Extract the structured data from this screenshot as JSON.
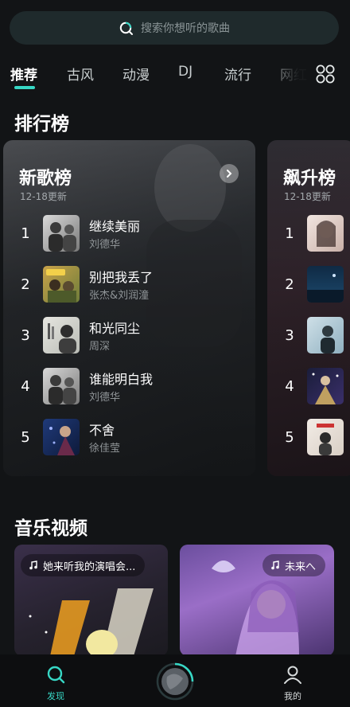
{
  "search": {
    "placeholder": "搜索你想听的歌曲"
  },
  "tabs": [
    {
      "label": "推荐",
      "active": true
    },
    {
      "label": "古风"
    },
    {
      "label": "动漫"
    },
    {
      "label": "DJ"
    },
    {
      "label": "流行"
    },
    {
      "label": "网红"
    }
  ],
  "sections": {
    "charts_title": "排行榜",
    "mv_title": "音乐视频"
  },
  "charts": [
    {
      "title": "新歌榜",
      "date": "12-18更新",
      "rows": [
        {
          "rank": "1",
          "song": "继续美丽",
          "artist": "刘德华"
        },
        {
          "rank": "2",
          "song": "别把我丢了",
          "artist": "张杰&刘润潼"
        },
        {
          "rank": "3",
          "song": "和光同尘",
          "artist": "周深"
        },
        {
          "rank": "4",
          "song": "谁能明白我",
          "artist": "刘德华"
        },
        {
          "rank": "5",
          "song": "不舍",
          "artist": "徐佳莹"
        }
      ]
    },
    {
      "title": "飙升榜",
      "date": "12-18更新",
      "rows": [
        {
          "rank": "1"
        },
        {
          "rank": "2"
        },
        {
          "rank": "3"
        },
        {
          "rank": "4"
        },
        {
          "rank": "5"
        }
      ]
    }
  ],
  "videos": [
    {
      "title": "她来听我的演唱会..."
    },
    {
      "title": "未来へ"
    }
  ],
  "nav": {
    "discover": "发现",
    "mine": "我的"
  },
  "colors": {
    "accent": "#37d7c5",
    "background": "#121416"
  }
}
